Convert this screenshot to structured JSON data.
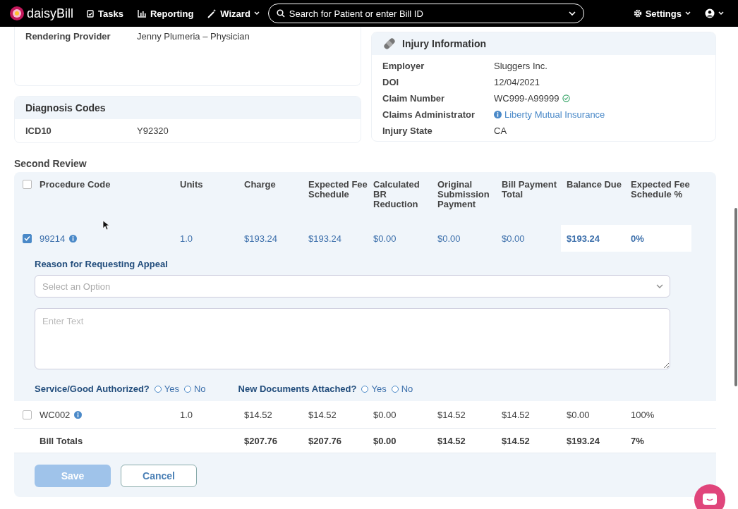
{
  "nav": {
    "brand": "daisyBill",
    "items": [
      {
        "label": "Tasks",
        "dropdown": false
      },
      {
        "label": "Reporting",
        "dropdown": false
      },
      {
        "label": "Wizard",
        "dropdown": true
      }
    ],
    "search": {
      "placeholder": "Search for Patient or enter Bill ID"
    },
    "settings": "Settings"
  },
  "provider_card": {
    "rows": [
      {
        "label": "Rendering Provider",
        "value": "Jenny Plumeria – Physician"
      }
    ]
  },
  "diagnosis": {
    "title": "Diagnosis Codes",
    "rows": [
      {
        "label": "ICD10",
        "value": "Y92320"
      }
    ]
  },
  "injury": {
    "title": "Injury Information",
    "rows": [
      {
        "label": "Employer",
        "value": "Sluggers Inc.",
        "kind": "text"
      },
      {
        "label": "DOI",
        "value": "12/04/2021",
        "kind": "text"
      },
      {
        "label": "Claim Number",
        "value": "WC999-A99999",
        "kind": "verified"
      },
      {
        "label": "Claims Administrator",
        "value": "Liberty Mutual Insurance",
        "kind": "link"
      },
      {
        "label": "Injury State",
        "value": "CA",
        "kind": "text"
      }
    ]
  },
  "review": {
    "title": "Second Review",
    "select_all": {
      "checked": false
    },
    "columns": [
      "Procedure Code",
      "Units",
      "Charge",
      "Expected Fee Schedule",
      "Calculated BR Reduction",
      "Original Submission Payment",
      "Bill Payment Total",
      "Balance Due",
      "Expected Fee Schedule %"
    ],
    "rows": [
      {
        "checked": true,
        "cells": [
          "99214",
          "1.0",
          "$193.24",
          "$193.24",
          "$0.00",
          "$0.00",
          "$0.00",
          "$193.24",
          "0%"
        ],
        "appeal": {
          "reason_label": "Reason for Requesting Appeal",
          "select_placeholder": "Select an Option",
          "text_placeholder": "Enter Text",
          "questions": [
            {
              "label": "Service/Good Authorized?",
              "options": [
                {
                  "label": "Yes",
                  "selected": false
                },
                {
                  "label": "No",
                  "selected": false
                }
              ]
            },
            {
              "label": "New Documents Attached?",
              "options": [
                {
                  "label": "Yes",
                  "selected": false
                },
                {
                  "label": "No",
                  "selected": false
                }
              ]
            }
          ]
        }
      },
      {
        "checked": false,
        "cells": [
          "WC002",
          "1.0",
          "$14.52",
          "$14.52",
          "$0.00",
          "$14.52",
          "$14.52",
          "$0.00",
          "100%"
        ]
      }
    ],
    "totals": {
      "cells": [
        "Bill Totals",
        "",
        "$207.76",
        "$207.76",
        "$0.00",
        "$14.52",
        "$14.52",
        "$193.24",
        "7%"
      ]
    },
    "buttons": [
      {
        "label": "Save",
        "disabled": true,
        "kind": "primary"
      },
      {
        "label": "Cancel",
        "disabled": false,
        "kind": "secondary"
      }
    ]
  }
}
